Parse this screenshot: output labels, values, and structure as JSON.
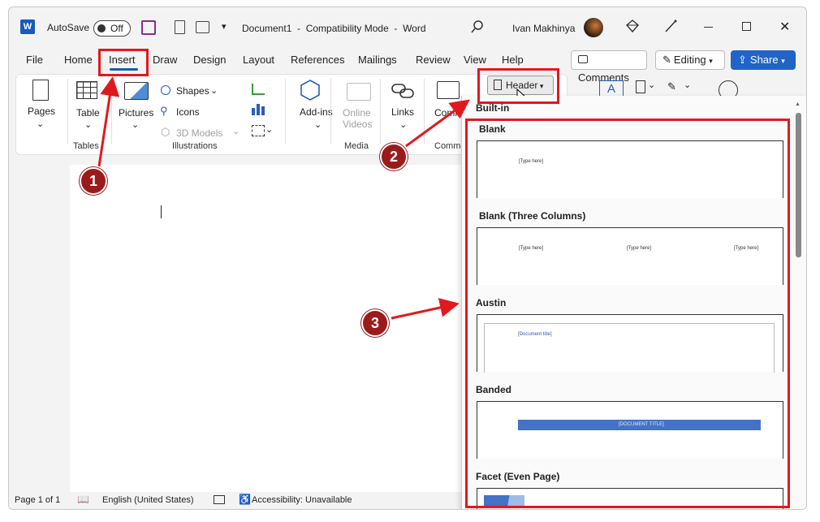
{
  "titlebar": {
    "autosave_label": "AutoSave",
    "autosave_state": "Off",
    "document_title": "Document1  -  Compatibility Mode  -  Word",
    "user_name": "Ivan Makhinya"
  },
  "tabs": [
    "File",
    "Home",
    "Insert",
    "Draw",
    "Design",
    "Layout",
    "References",
    "Mailings",
    "Review",
    "View",
    "Help"
  ],
  "actions": {
    "comments": "Comments",
    "editing": "Editing",
    "share": "Share"
  },
  "ribbon": {
    "pages": "Pages",
    "table": "Table",
    "pictures": "Pictures",
    "shapes": "Shapes",
    "icons": "Icons",
    "models3d": "3D Models",
    "addins": "Add-ins",
    "online_videos_1": "Online",
    "online_videos_2": "Videos",
    "links": "Links",
    "comment": "Comme",
    "header": "Header",
    "groups": {
      "tables": "Tables",
      "illustrations": "Illustrations",
      "media": "Media",
      "comments": "Commen"
    }
  },
  "gallery": {
    "section": "Built-in",
    "items": [
      {
        "name": "Blank",
        "placeholders": [
          "[Type here]"
        ]
      },
      {
        "name": "Blank (Three Columns)",
        "placeholders": [
          "[Type here]",
          "[Type here]",
          "[Type here]"
        ]
      },
      {
        "name": "Austin",
        "placeholders": [
          "[Document title]"
        ]
      },
      {
        "name": "Banded",
        "placeholders": [
          "[DOCUMENT TITLE]"
        ]
      },
      {
        "name": "Facet (Even Page)",
        "placeholders": []
      }
    ]
  },
  "status": {
    "page": "Page 1 of 1",
    "language": "English (United States)",
    "accessibility": "Accessibility: Unavailable"
  },
  "annotations": [
    "1",
    "2",
    "3"
  ],
  "colors": {
    "word_blue": "#185abd",
    "share_blue": "#2163c6",
    "annotation_red": "#e0191e",
    "badge_red": "#9b1b1b"
  }
}
